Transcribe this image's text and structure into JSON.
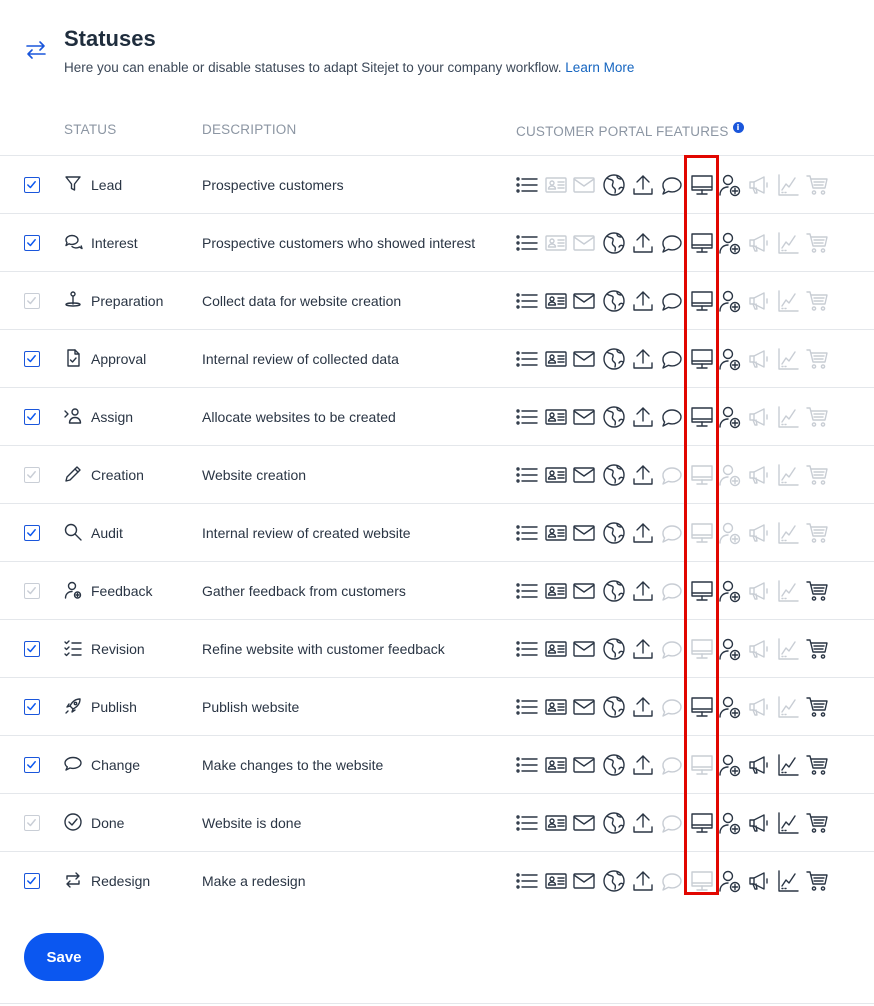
{
  "header": {
    "title": "Statuses",
    "subtitle": "Here you can enable or disable statuses to adapt Sitejet to your company workflow.",
    "learn_more": "Learn More",
    "icon": "swap-arrows-icon"
  },
  "columns": {
    "status": "STATUS",
    "description": "DESCRIPTION",
    "portal": "CUSTOMER PORTAL FEATURES"
  },
  "colors": {
    "accent": "#0b57f0",
    "active_icon": "#2a3544",
    "inactive_icon": "#c8cdd4",
    "highlight": "#e10600"
  },
  "feature_names": [
    "list-icon",
    "contact-card-icon",
    "mail-icon",
    "globe-icon",
    "upload-icon",
    "comment-icon",
    "monitor-icon",
    "add-user-icon",
    "megaphone-icon",
    "chart-icon",
    "cart-icon"
  ],
  "statuses": [
    {
      "label": "Lead",
      "description": "Prospective customers",
      "icon": "funnel-icon",
      "checked": true,
      "features": [
        1,
        0,
        0,
        1,
        1,
        1,
        1,
        1,
        0,
        0,
        0
      ]
    },
    {
      "label": "Interest",
      "description": "Prospective customers who showed interest",
      "icon": "chat-bubbles-icon",
      "checked": true,
      "features": [
        1,
        0,
        0,
        1,
        1,
        1,
        1,
        1,
        0,
        0,
        0
      ]
    },
    {
      "label": "Preparation",
      "description": "Collect data for website creation",
      "icon": "joystick-icon",
      "checked": false,
      "features": [
        1,
        1,
        1,
        1,
        1,
        1,
        1,
        1,
        0,
        0,
        0
      ]
    },
    {
      "label": "Approval",
      "description": "Internal review of collected data",
      "icon": "document-check-icon",
      "checked": true,
      "features": [
        1,
        1,
        1,
        1,
        1,
        1,
        1,
        1,
        0,
        0,
        0
      ]
    },
    {
      "label": "Assign",
      "description": "Allocate websites to be created",
      "icon": "assign-user-icon",
      "checked": true,
      "features": [
        1,
        1,
        1,
        1,
        1,
        1,
        1,
        1,
        0,
        0,
        0
      ]
    },
    {
      "label": "Creation",
      "description": "Website creation",
      "icon": "pencil-icon",
      "checked": false,
      "features": [
        1,
        1,
        1,
        1,
        1,
        0,
        0,
        0,
        0,
        0,
        0
      ]
    },
    {
      "label": "Audit",
      "description": "Internal review of created website",
      "icon": "magnifier-icon",
      "checked": true,
      "features": [
        1,
        1,
        1,
        1,
        1,
        0,
        0,
        0,
        0,
        0,
        0
      ]
    },
    {
      "label": "Feedback",
      "description": "Gather feedback from customers",
      "icon": "user-feedback-icon",
      "checked": false,
      "features": [
        1,
        1,
        1,
        1,
        1,
        0,
        1,
        1,
        0,
        0,
        1
      ]
    },
    {
      "label": "Revision",
      "description": "Refine website with customer feedback",
      "icon": "checklist-icon",
      "checked": true,
      "features": [
        1,
        1,
        1,
        1,
        1,
        0,
        0,
        1,
        0,
        0,
        1
      ]
    },
    {
      "label": "Publish",
      "description": "Publish website",
      "icon": "rocket-icon",
      "checked": true,
      "features": [
        1,
        1,
        1,
        1,
        1,
        0,
        1,
        1,
        0,
        0,
        1
      ]
    },
    {
      "label": "Change",
      "description": "Make changes to the website",
      "icon": "speech-bubble-icon",
      "checked": true,
      "features": [
        1,
        1,
        1,
        1,
        1,
        0,
        0,
        1,
        1,
        1,
        1
      ]
    },
    {
      "label": "Done",
      "description": "Website is done",
      "icon": "check-circle-icon",
      "checked": false,
      "features": [
        1,
        1,
        1,
        1,
        1,
        0,
        1,
        1,
        1,
        1,
        1
      ]
    },
    {
      "label": "Redesign",
      "description": "Make a redesign",
      "icon": "repeat-icon",
      "checked": true,
      "features": [
        1,
        1,
        1,
        1,
        1,
        0,
        0,
        1,
        1,
        1,
        1
      ]
    }
  ],
  "save_label": "Save"
}
